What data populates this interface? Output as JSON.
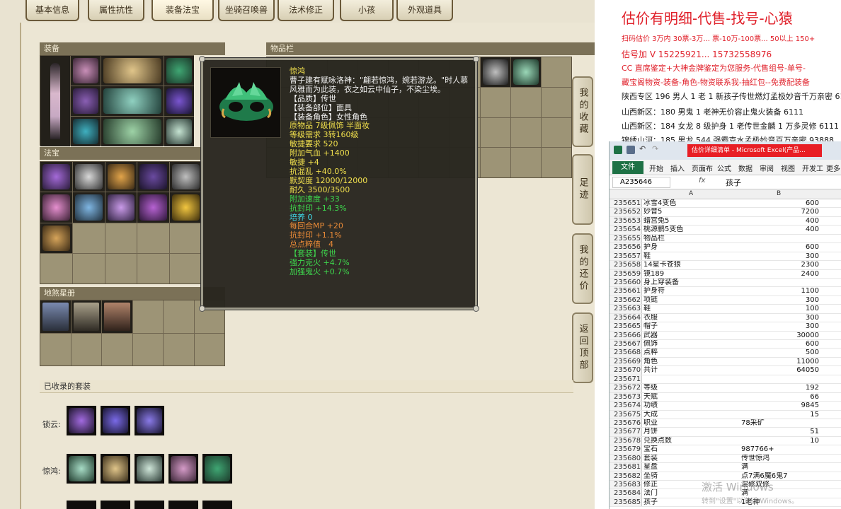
{
  "tabs": [
    "基本信息",
    "属性抗性",
    "装备法宝",
    "坐骑召唤兽",
    "法术修正",
    "小孩",
    "外观道具"
  ],
  "active_tab": "装备法宝",
  "panels": {
    "equipment": "装备",
    "inventory": "物品栏",
    "treasure": "法宝",
    "constellation": "地煞星册",
    "suits": "已收录的套装"
  },
  "tooltip": {
    "name": "惊鸿",
    "desc": "曹子建有赋咏洛神：\"翩若惊鸿，婉若游龙。\"时人慕风雅而为此装，衣之如云中仙子，不染尘埃。",
    "lines": [
      {
        "text": "【品质】传世",
        "color": "l-white"
      },
      {
        "text": "【装备部位】面具",
        "color": "l-white"
      },
      {
        "text": "【装备角色】女性角色",
        "color": "l-white"
      },
      {
        "text": "原物品 7级佩饰 半面妆",
        "color": "l-yellow"
      },
      {
        "text": "等级需求 3转160级",
        "color": "l-yellow"
      },
      {
        "text": "敏捷要求 520",
        "color": "l-yellow"
      },
      {
        "text": "附加气血 +1400",
        "color": "l-yellow"
      },
      {
        "text": "敏捷 +4",
        "color": "l-yellow"
      },
      {
        "text": "抗混乱 +40.0%",
        "color": "l-yellow"
      },
      {
        "text": "默契度 12000/12000",
        "color": "l-yellow"
      },
      {
        "text": "耐久 3500/3500",
        "color": "l-yellow"
      },
      {
        "text": "附加速度 +33",
        "color": "l-green"
      },
      {
        "text": "抗封印 +14.3%",
        "color": "l-green"
      },
      {
        "text": "培养 0",
        "color": "l-cyan"
      },
      {
        "text": "每回合MP +20",
        "color": "l-orange"
      },
      {
        "text": "抗封印 +1.1%",
        "color": "l-orange"
      },
      {
        "text": "总点粹值　4",
        "color": "l-orange"
      },
      {
        "text": " ",
        "color": "l-white"
      },
      {
        "text": " ",
        "color": "l-white"
      },
      {
        "text": "【套装】传世",
        "color": "l-green"
      },
      {
        "text": "强力克火 +4.7%",
        "color": "l-green"
      },
      {
        "text": "加强鬼火 +0.7%",
        "color": "l-green"
      }
    ]
  },
  "side_buttons": [
    "我的收藏",
    "足迹",
    "我的还价",
    "返回顶部"
  ],
  "suits": [
    {
      "label": "锁云:"
    },
    {
      "label": "惊鸿:"
    }
  ],
  "ad": {
    "title": "估价有明细-代售-找号-心猿",
    "lines": [
      {
        "text": "扫码估价 3万内 30票-3万... 票-10万-100票... 50以上 150+",
        "cls": "red"
      },
      {
        "text": "估号加 V 15225921... 15732558976",
        "cls": "red"
      },
      {
        "text": "CC 直席鉴定+大神金牌鉴定为您服务-代售组号-单号-",
        "cls": "red"
      },
      {
        "text": "藏宝阁物资-装备-角色-物资联系我-抽红包--免费配装备",
        "cls": "red"
      },
      {
        "text": "陕西专区 196 男人 1 老 1 新孩子传世燃灯孟极妙音千万亲密 6111",
        "cls": "dark"
      },
      {
        "text": "山西新区：180 男鬼 1 老神无价容止鬼火装备 6111",
        "cls": "dark"
      },
      {
        "text": "山西新区：184 女龙 8 级护身 1 老传世金麟 1 万多灵修 6111",
        "cls": "dark"
      },
      {
        "text": "锦绣山河：185 男龙 544 强霸克水孟极妙音百万亲密 93888",
        "cls": "dark"
      }
    ]
  },
  "excel": {
    "title": "估价详细清单 - Microsoft Excel(产品...",
    "file_tab": "文件",
    "menu": [
      "开始",
      "插入",
      "页面布",
      "公式",
      "数据",
      "审阅",
      "视图",
      "开发工",
      "更多"
    ],
    "name_box": "A235646",
    "fx": "fx",
    "formula": "孩子",
    "col_a": "A",
    "col_b": "B",
    "rows": [
      {
        "n": "235651",
        "a": "冰雪4变色",
        "b": "600",
        "r": true
      },
      {
        "n": "235652",
        "a": "妙音5",
        "b": "7200",
        "r": true
      },
      {
        "n": "235653",
        "a": "蜡宫兔5",
        "b": "400",
        "r": true
      },
      {
        "n": "235654",
        "a": "桃源鹏5变色",
        "b": "400",
        "r": true
      },
      {
        "n": "235655",
        "a": "物品栏",
        "b": "",
        "r": true
      },
      {
        "n": "235656",
        "a": "护身",
        "b": "600",
        "r": true
      },
      {
        "n": "235657",
        "a": "鞋",
        "b": "300",
        "r": true
      },
      {
        "n": "235658",
        "a": "14星卡苍狼",
        "b": "2300",
        "r": true
      },
      {
        "n": "235659",
        "a": "镜189",
        "b": "2400",
        "r": true
      },
      {
        "n": "235660",
        "a": "身上穿装备",
        "b": "",
        "r": true
      },
      {
        "n": "235661",
        "a": "护身符",
        "b": "1100",
        "r": true
      },
      {
        "n": "235662",
        "a": "项链",
        "b": "300",
        "r": true
      },
      {
        "n": "235663",
        "a": "鞋",
        "b": "100",
        "r": true
      },
      {
        "n": "235664",
        "a": "衣服",
        "b": "300",
        "r": true
      },
      {
        "n": "235665",
        "a": "帽子",
        "b": "300",
        "r": true
      },
      {
        "n": "235666",
        "a": "武器",
        "b": "30000",
        "r": true
      },
      {
        "n": "235667",
        "a": "佩饰",
        "b": "600",
        "r": true
      },
      {
        "n": "235668",
        "a": "点粹",
        "b": "500",
        "r": true
      },
      {
        "n": "235669",
        "a": "角色",
        "b": "11000",
        "r": true
      },
      {
        "n": "235670",
        "a": "共计",
        "b": "64050",
        "r": true
      },
      {
        "n": "235671",
        "a": "",
        "b": "",
        "r": true
      },
      {
        "n": "235672",
        "a": "等级",
        "b": "192",
        "r": true
      },
      {
        "n": "235673",
        "a": "天赋",
        "b": "66",
        "r": true
      },
      {
        "n": "235674",
        "a": "功绩",
        "b": "9845",
        "r": true
      },
      {
        "n": "235675",
        "a": "大成",
        "b": "15",
        "r": true
      },
      {
        "n": "235676",
        "a": "职业",
        "b": "78采矿",
        "r": false
      },
      {
        "n": "235677",
        "a": "月饼",
        "b": "51",
        "r": true
      },
      {
        "n": "235678",
        "a": "兑换点数",
        "b": "10",
        "r": true
      },
      {
        "n": "235679",
        "a": "宝石",
        "b": "987766+",
        "r": false
      },
      {
        "n": "235680",
        "a": "套装",
        "b": "传世惊鸿",
        "r": false
      },
      {
        "n": "235681",
        "a": "星盘",
        "b": "满",
        "r": false
      },
      {
        "n": "235682",
        "a": "坐骑",
        "b": "点7满6魔6鬼7",
        "r": false
      },
      {
        "n": "235683",
        "a": "修正",
        "b": "混修双修",
        "r": false
      },
      {
        "n": "235684",
        "a": "法门",
        "b": "满",
        "r": false
      },
      {
        "n": "235685",
        "a": "孩子",
        "b": "1老神",
        "r": false
      }
    ]
  },
  "watermark": {
    "line1": "激活 Windows",
    "line2": "转到\"设置\"以激活 Windows。"
  },
  "colors": {
    "accent_red": "#e0202a",
    "excel_green": "#1e7145",
    "tooltip_bg": "#28251e"
  }
}
